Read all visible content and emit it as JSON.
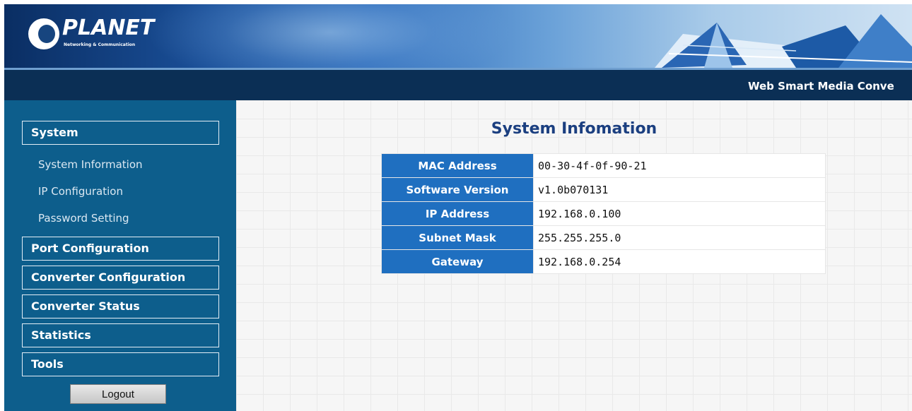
{
  "header": {
    "logo_text": "PLANET",
    "logo_tagline": "Networking & Communication",
    "product_title": "Web Smart Media Conve"
  },
  "sidebar": {
    "menus": [
      {
        "label": "System"
      },
      {
        "label": "Port Configuration"
      },
      {
        "label": "Converter Configuration"
      },
      {
        "label": "Converter Status"
      },
      {
        "label": "Statistics"
      },
      {
        "label": "Tools"
      }
    ],
    "system_items": [
      {
        "label": "System Information"
      },
      {
        "label": "IP Configuration"
      },
      {
        "label": "Password Setting"
      }
    ],
    "logout_label": "Logout"
  },
  "main": {
    "title": "System Infomation",
    "rows": [
      {
        "label": "MAC Address",
        "value": "00-30-4f-0f-90-21"
      },
      {
        "label": "Software Version",
        "value": "v1.0b070131"
      },
      {
        "label": "IP Address",
        "value": "192.168.0.100"
      },
      {
        "label": "Subnet Mask",
        "value": "255.255.255.0"
      },
      {
        "label": "Gateway",
        "value": "192.168.0.254"
      }
    ]
  },
  "colors": {
    "sidebar_bg": "#0d5e8c",
    "titlebar_bg": "#0b2f55",
    "table_label_bg": "#1f6fc0",
    "title_color": "#1b3f80"
  }
}
